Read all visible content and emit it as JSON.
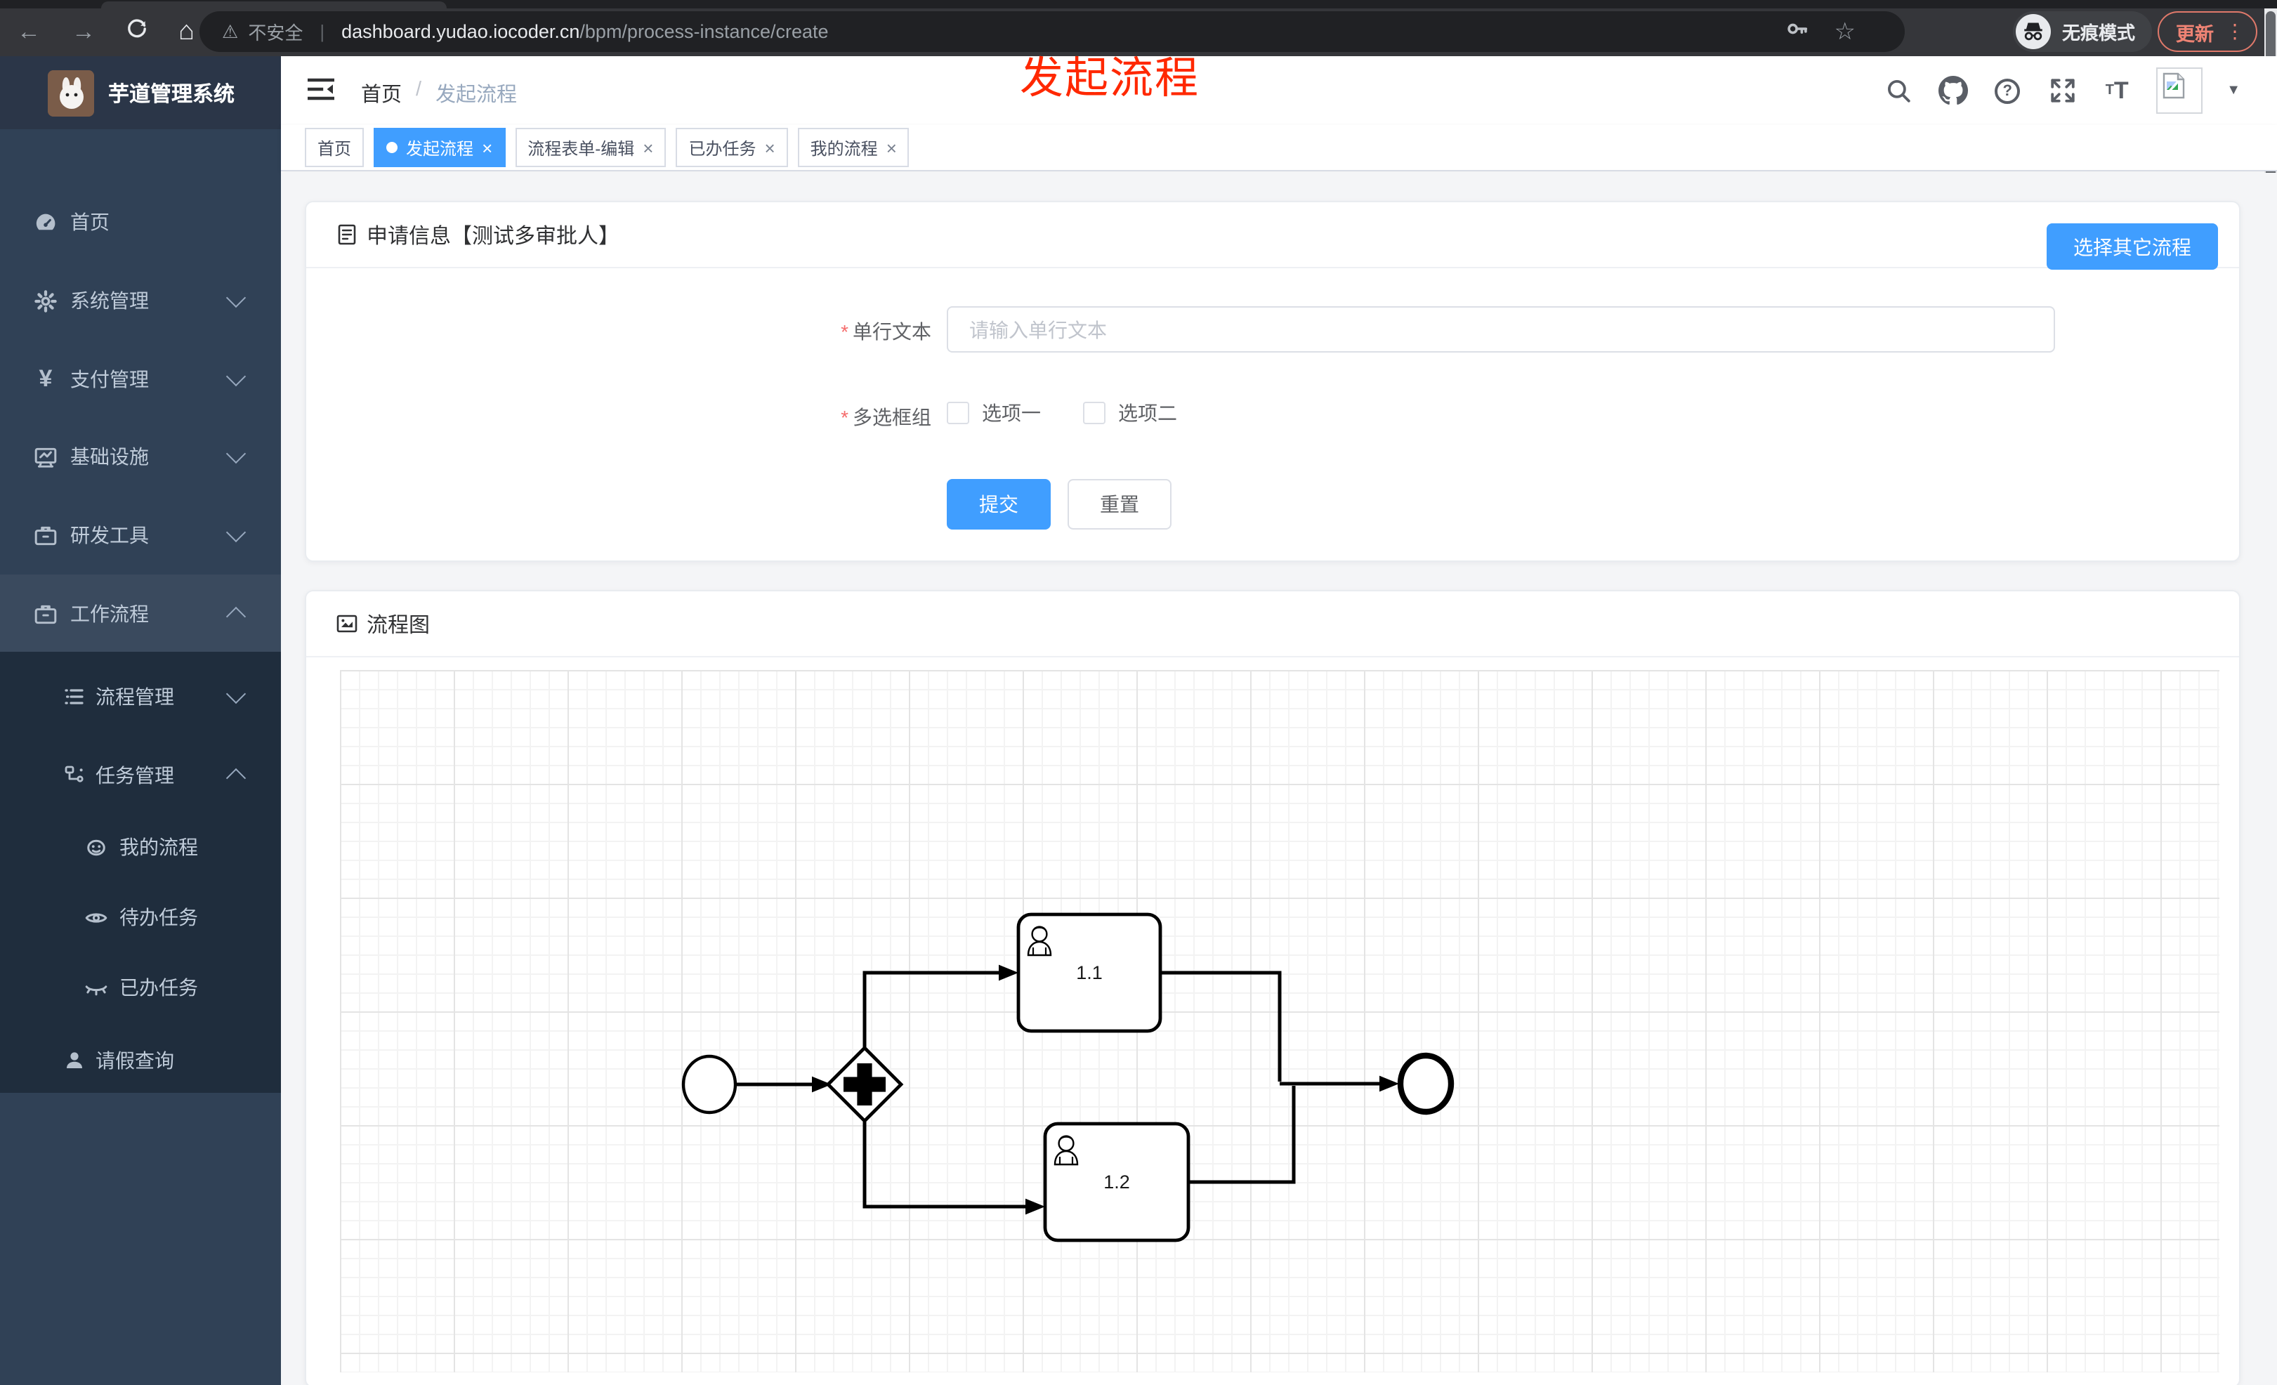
{
  "browser": {
    "security_label": "不安全",
    "url_host": "dashboard.yudao.iocoder.cn",
    "url_path": "/bpm/process-instance/create",
    "incognito_label": "无痕模式",
    "update_label": "更新",
    "menu_dots": "⋮",
    "back_glyph": "←",
    "forward_glyph": "→",
    "home_glyph": "⌂",
    "warning_glyph": "⚠",
    "star_glyph": "☆",
    "divider_glyph": "|"
  },
  "annotation": {
    "text": "发起流程",
    "color": "#ff2800"
  },
  "sidebar": {
    "app_title": "芋道管理系统",
    "items": [
      {
        "label": "首页",
        "level": 1,
        "icon": "dashboard-icon"
      },
      {
        "label": "系统管理",
        "level": 1,
        "icon": "gear-icon",
        "expand": "down"
      },
      {
        "label": "支付管理",
        "level": 1,
        "icon": "yen-icon",
        "expand": "down"
      },
      {
        "label": "基础设施",
        "level": 1,
        "icon": "monitor-icon",
        "expand": "down"
      },
      {
        "label": "研发工具",
        "level": 1,
        "icon": "toolbox-icon",
        "expand": "down"
      },
      {
        "label": "工作流程",
        "level": 1,
        "icon": "toolbox-icon",
        "expand": "up",
        "open": true
      },
      {
        "label": "流程管理",
        "level": 2,
        "icon": "tree-list-icon",
        "expand": "down"
      },
      {
        "label": "任务管理",
        "level": 2,
        "icon": "flow-nodes-icon",
        "expand": "up",
        "open": true
      },
      {
        "label": "我的流程",
        "level": 3,
        "icon": "face-icon"
      },
      {
        "label": "待办任务",
        "level": 3,
        "icon": "eye-icon"
      },
      {
        "label": "已办任务",
        "level": 3,
        "icon": "eye-closed-icon"
      },
      {
        "label": "请假查询",
        "level": 2,
        "icon": "person-icon"
      }
    ],
    "yen_glyph": "¥"
  },
  "header": {
    "breadcrumb": {
      "root": "首页",
      "separator": "/",
      "current": "发起流程"
    },
    "dropdown_glyph": "▼",
    "question_glyph": "?",
    "font_small": "T",
    "font_big": "T"
  },
  "tabs": [
    {
      "label": "首页",
      "active": false,
      "closable": false
    },
    {
      "label": "发起流程",
      "active": true,
      "closable": true
    },
    {
      "label": "流程表单-编辑",
      "active": false,
      "closable": true
    },
    {
      "label": "已办任务",
      "active": false,
      "closable": true
    },
    {
      "label": "我的流程",
      "active": false,
      "closable": true
    }
  ],
  "close_glyph": "×",
  "form_card": {
    "title": "申请信息【测试多审批人】",
    "action_button": "选择其它流程",
    "required_marker": "*",
    "fields": [
      {
        "label": "单行文本",
        "required": true,
        "type": "text",
        "value": "",
        "placeholder": "请输入单行文本"
      },
      {
        "label": "多选框组",
        "required": true,
        "type": "checkbox-group",
        "options": [
          {
            "label": "选项一",
            "checked": false
          },
          {
            "label": "选项二",
            "checked": false
          }
        ]
      }
    ],
    "submit_label": "提交",
    "reset_label": "重置"
  },
  "diagram_card": {
    "title": "流程图",
    "type": "bpmn",
    "nodes": [
      {
        "id": "start",
        "type": "start-event"
      },
      {
        "id": "gateway",
        "type": "parallel-gateway"
      },
      {
        "id": "task1",
        "type": "user-task",
        "label": "1.1"
      },
      {
        "id": "task2",
        "type": "user-task",
        "label": "1.2"
      },
      {
        "id": "end",
        "type": "end-event"
      }
    ],
    "edges": [
      "start→gateway",
      "gateway→task1",
      "gateway→task2",
      "task1→join",
      "task2→join",
      "join→end"
    ]
  },
  "colors": {
    "accent": "#409eff",
    "sidebar_bg": "#304156",
    "submenu_bg": "#1f2d3d",
    "annotation_red": "#ff2800",
    "update_salmon": "#ee8374",
    "content_bg": "#f4f5f7"
  }
}
